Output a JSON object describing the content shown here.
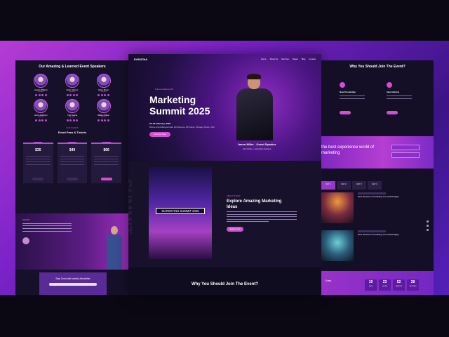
{
  "left": {
    "speakers_heading": "Our Amazing & Learned Event Speakers",
    "speakers": [
      {
        "name": "Jayden Williams",
        "role": "Speaker"
      },
      {
        "name": "Noah Johnson",
        "role": "Speaker"
      },
      {
        "name": "Ethan Brown",
        "role": "Speaker"
      },
      {
        "name": "Henry Anderson",
        "role": "Speaker"
      },
      {
        "name": "Tyler Garcia",
        "role": "Speaker"
      },
      {
        "name": "William Wilson",
        "role": "Speaker"
      }
    ],
    "tickets_tag": "OUR TICKETS",
    "tickets_heading": "Event Pass & Tickets",
    "prices": [
      "$35",
      "$49",
      "$66"
    ],
    "testimonial_tag": "REVIEW",
    "newsletter_title": "Stay Tuned with weekly Newsletter"
  },
  "center": {
    "logo": "EVENTNA",
    "nav": [
      "Home",
      "About Us",
      "Services",
      "Pages",
      "Blog",
      "Contact"
    ],
    "hero_tag": "Future Academy 25",
    "hero_title": "Marketing Summit 2025",
    "hero_date": "20–25 February, 2025",
    "hero_venue": "Mitone Arena Banquet Hall, 23rd Avenue, 6th Street, Chicago, Illinois, USA",
    "hero_button": "Get Free Seat",
    "guest_name": "Jason Miller - Guest Speaker",
    "guest_sub": "Join Online + Interactive Session",
    "about_ghost": "SUMMIT",
    "about_sign": "MARKETING SUMMIT 2025",
    "about_tag": "ABOUT EVENT",
    "about_title": "Explore Amazing Marketing Ideas",
    "about_button": "Register Now",
    "why_title": "Why You Should Join The Event?"
  },
  "right": {
    "why_title": "Why You Should Join The Event?",
    "features": [
      "New Knowledge",
      "Idea Sharing"
    ],
    "band_text": "the best experience world of marketing",
    "tabs": [
      "DAY 1",
      "DAY 2",
      "DAY 3",
      "DAY 4"
    ],
    "events": [
      {
        "title": "New theories of marketing You should apply"
      },
      {
        "title": "New theories of marketing You should apply"
      }
    ],
    "countdown_text": "Event.",
    "countdown": [
      {
        "value": "19",
        "unit": "DAYS"
      },
      {
        "value": "23",
        "unit": "HOURS"
      },
      {
        "value": "52",
        "unit": "MINUTES"
      },
      {
        "value": "28",
        "unit": "SECONDS"
      }
    ]
  },
  "colors": {
    "accent": "#d14fd0",
    "panel": "#14102a",
    "background_start": "#c13fd6",
    "background_end": "#3b1486"
  }
}
